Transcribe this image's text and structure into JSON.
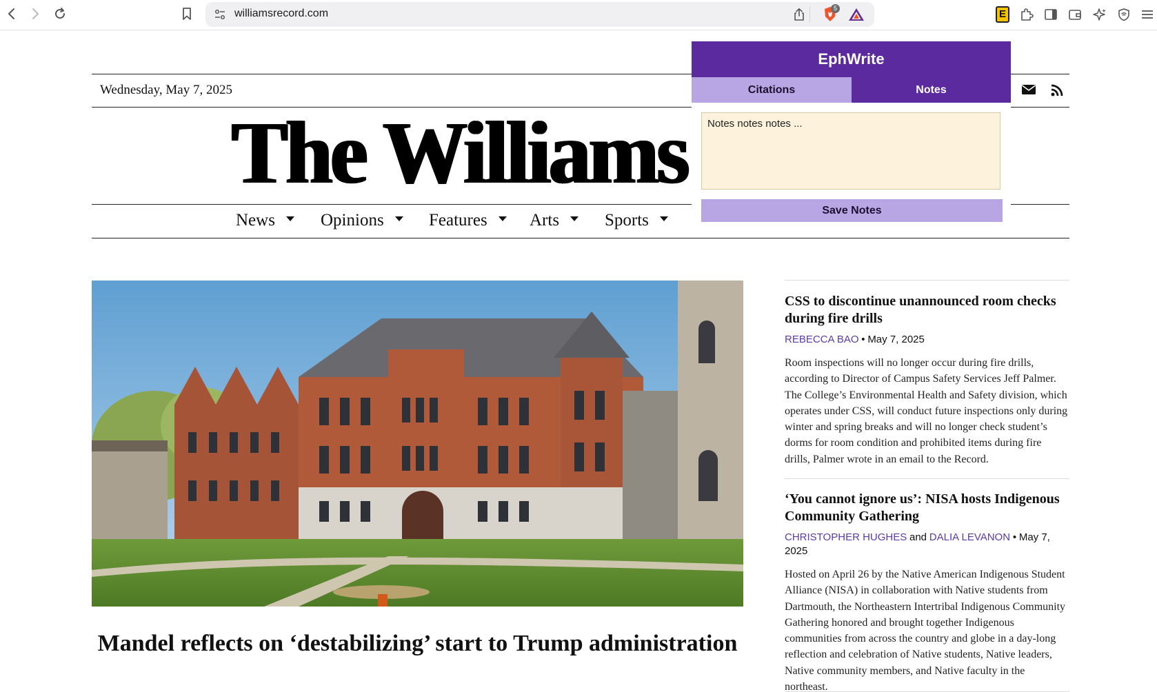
{
  "browser": {
    "url": "williamsrecord.com",
    "icons": {
      "back": "back-arrow-icon",
      "forward": "forward-arrow-icon",
      "reload": "reload-icon",
      "bookmark": "bookmark-icon",
      "site_settings": "site-settings-icon",
      "share": "share-icon",
      "brave_shields": "brave-shields-icon",
      "brave_rewards": "brave-rewards-icon"
    },
    "shields_count": "5",
    "extensions": [
      "ephwrite-extension-icon",
      "puzzle-extensions-icon",
      "sidebar-icon",
      "wallet-icon",
      "leo-sparkle-icon",
      "vpn-shield-icon",
      "menu-icon"
    ]
  },
  "site": {
    "date": "Wednesday, May 7, 2025",
    "masthead": "The Williams Record",
    "menu": [
      {
        "label": "News"
      },
      {
        "label": "Opinions"
      },
      {
        "label": "Features"
      },
      {
        "label": "Arts"
      },
      {
        "label": "Sports"
      }
    ],
    "social_icons": [
      "envelope-icon",
      "rss-icon"
    ]
  },
  "hero": {
    "title": "Mandel reflects on ‘destabilizing’ start to Trump administration",
    "image": "campus-building-photo"
  },
  "sidebar": {
    "articles": [
      {
        "title": "CSS to discontinue unannounced room checks during fire drills",
        "authors": [
          "REBECCA BAO"
        ],
        "date": "May 7, 2025",
        "excerpt": "Room inspections will no longer occur during fire drills, according to Director of Campus Safety Services Jeff Palmer. The College’s Environmental Health and Safety division, which operates under CSS, will conduct future inspections only during winter and spring breaks and will no longer check student’s dorms for room condition and prohibited items during fire drills, Palmer wrote in an email to the Record."
      },
      {
        "title": "‘You cannot ignore us’: NISA hosts Indigenous Community Gathering",
        "authors": [
          "CHRISTOPHER HUGHES",
          "DALIA LEVANON"
        ],
        "joiner": "and",
        "date": "May 7, 2025",
        "excerpt": "Hosted on April 26 by the Native American Indigenous Student Alliance (NISA) in collaboration with Native students from Dartmouth, the Northeastern Intertribal Indigenous Community Gathering honored and brought together Indigenous communities from across the country and globe in a day-long reflection and celebration of Native students, Native leaders, Native community members, and Native faculty in the northeast."
      }
    ],
    "bullet": "•"
  },
  "ephwrite": {
    "title": "EphWrite",
    "tabs": {
      "citations": "Citations",
      "notes": "Notes"
    },
    "active_tab": "notes",
    "notes_value": "Notes notes notes ...",
    "save_label": "Save Notes",
    "colors": {
      "header": "#5b2a9e",
      "tab_inactive": "#b7a6e3",
      "notes_bg": "#fdf2dc"
    }
  }
}
